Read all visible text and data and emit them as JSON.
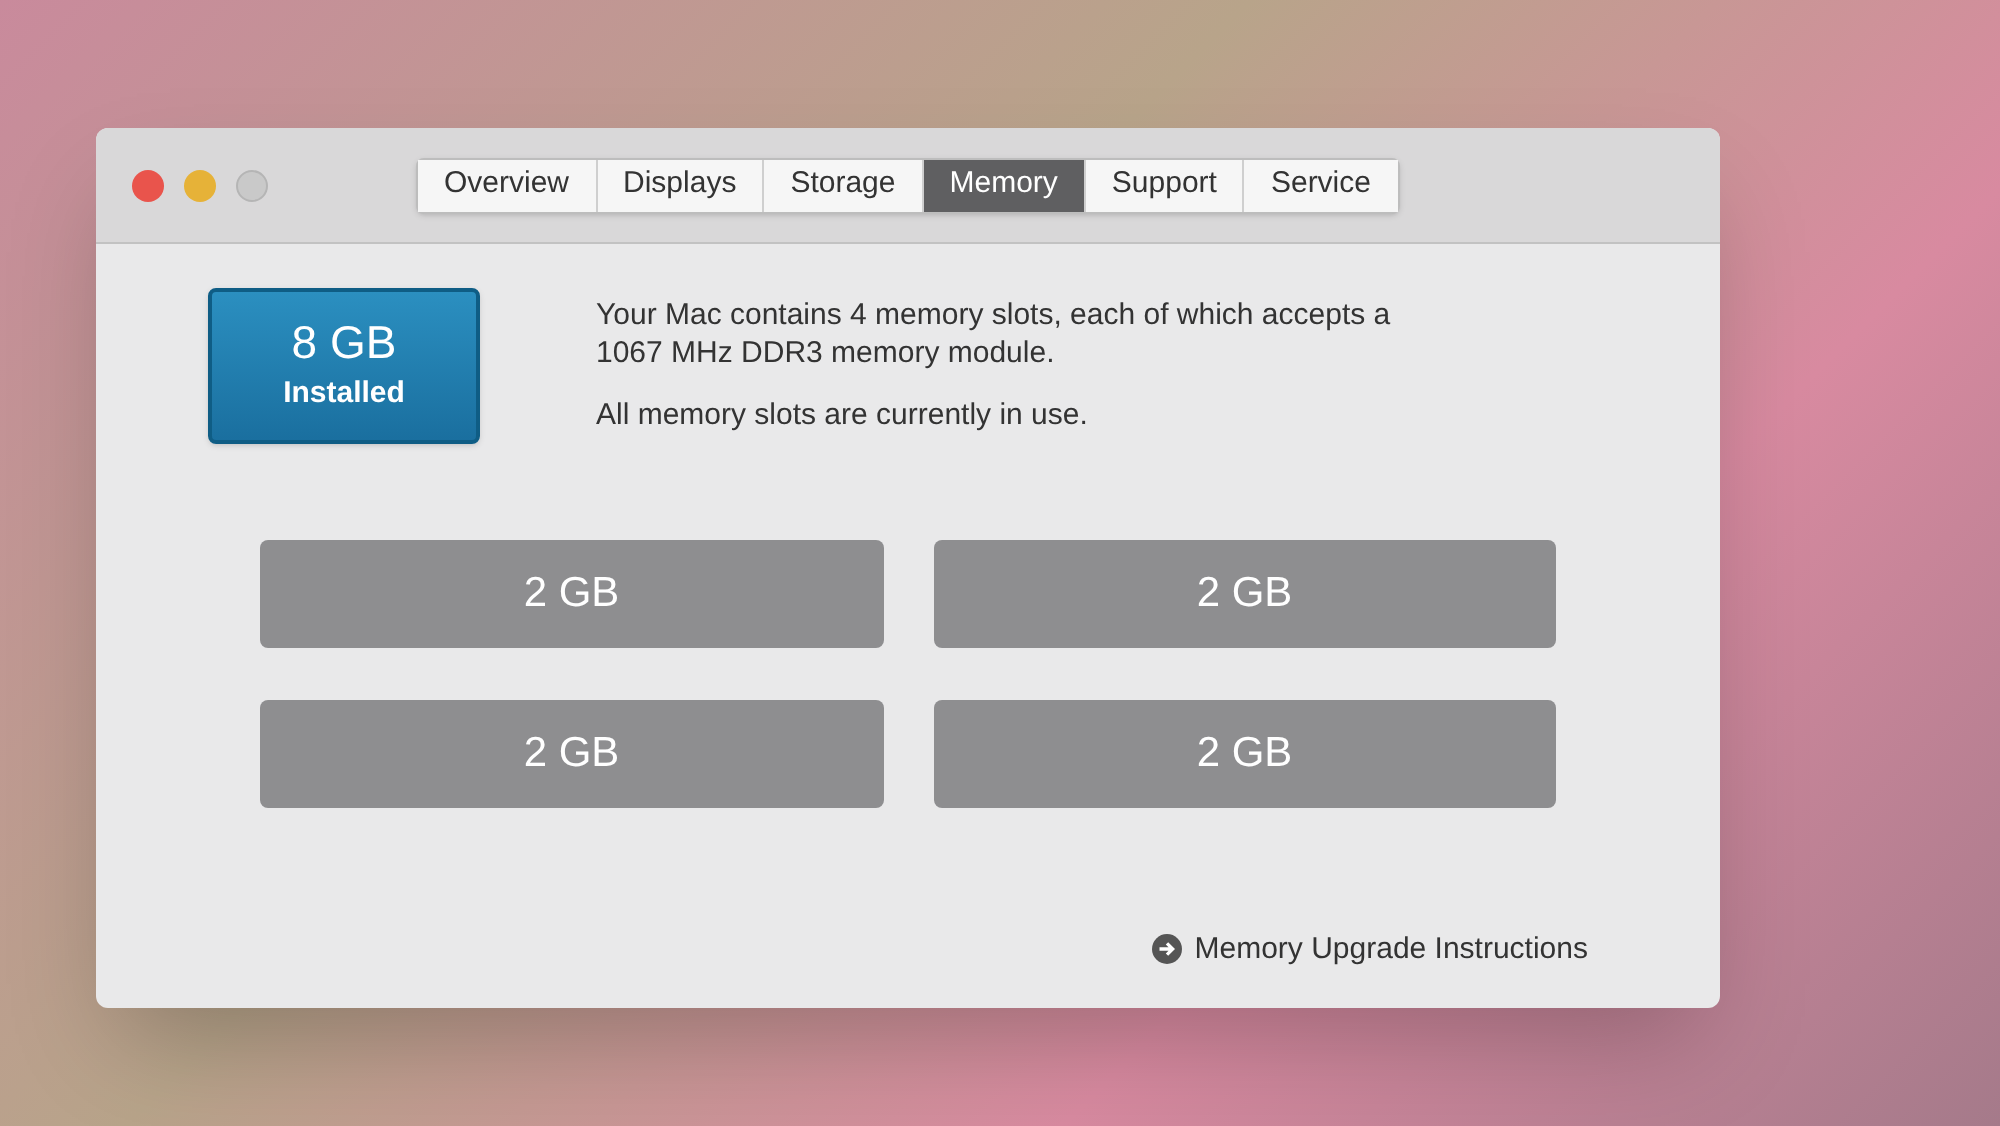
{
  "tabs": [
    {
      "label": "Overview",
      "selected": false
    },
    {
      "label": "Displays",
      "selected": false
    },
    {
      "label": "Storage",
      "selected": false
    },
    {
      "label": "Memory",
      "selected": true
    },
    {
      "label": "Support",
      "selected": false
    },
    {
      "label": "Service",
      "selected": false
    }
  ],
  "summary": {
    "amount": "8 GB",
    "label": "Installed"
  },
  "description": [
    "Your Mac contains 4 memory slots, each of which accepts a 1067 MHz DDR3 memory module.",
    "All memory slots are currently in use."
  ],
  "slots": [
    "2 GB",
    "2 GB",
    "2 GB",
    "2 GB"
  ],
  "link": "Memory Upgrade Instructions"
}
